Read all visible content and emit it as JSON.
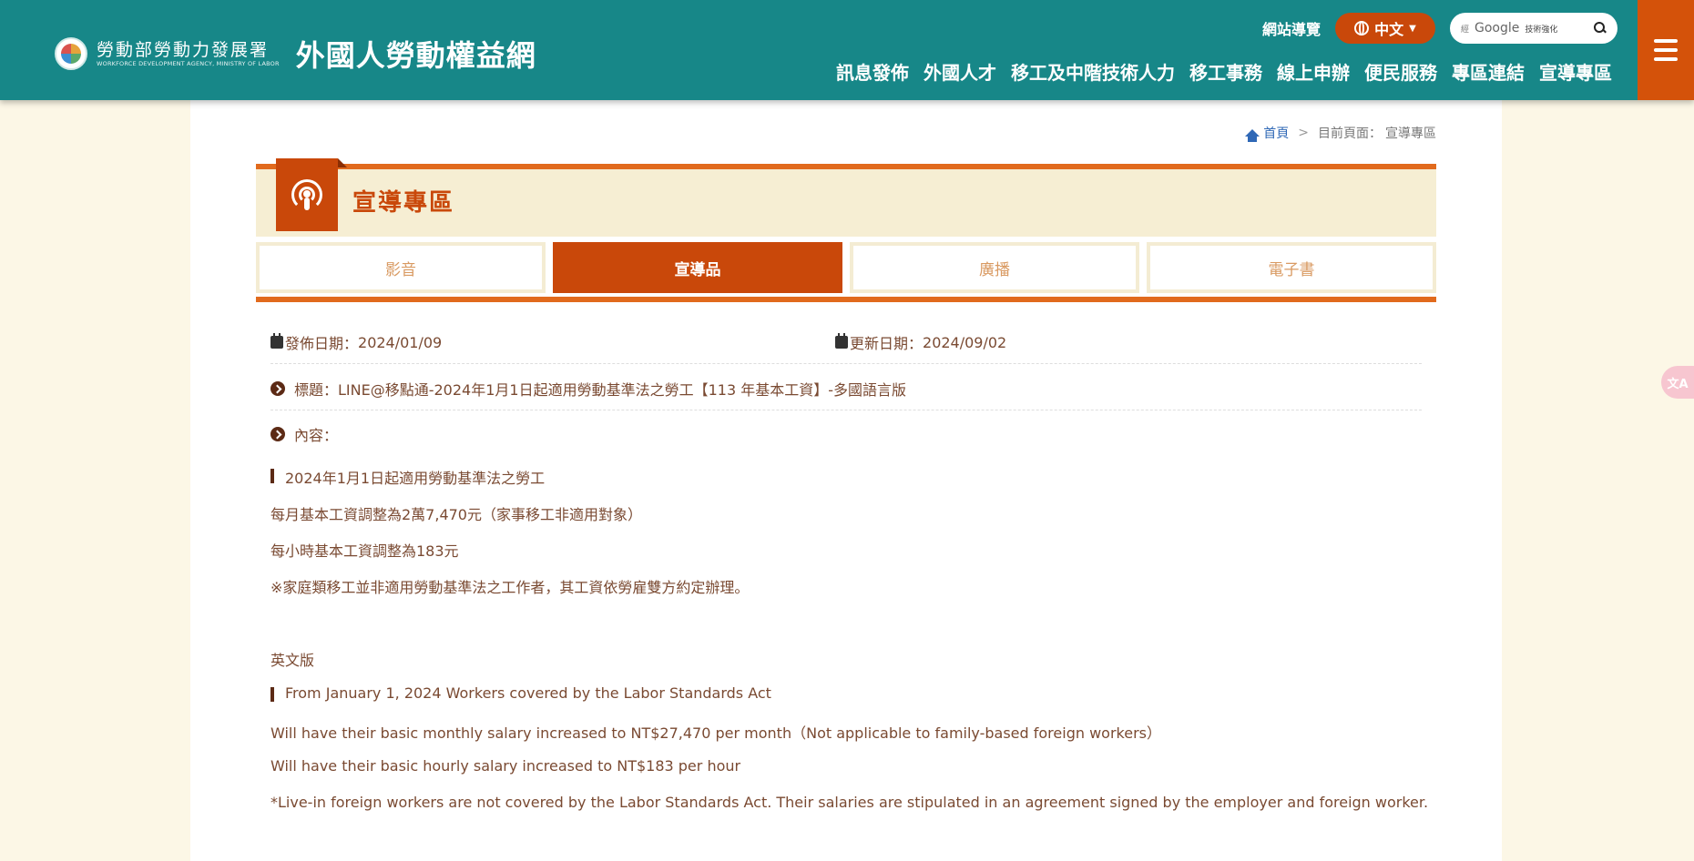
{
  "header": {
    "agency_zh": "勞動部勞動力發展署",
    "agency_en": "WORKFORCE DEVELOPMENT AGENCY, MINISTRY OF LABOR",
    "site_title": "外國人勞動權益網",
    "sitemap": "網站導覽",
    "language": "中文",
    "search_brand": "Google",
    "search_sub": "技術強化",
    "search_mark": "經",
    "nav": [
      "訊息發佈",
      "外國人才",
      "移工及中階技術人力",
      "移工事務",
      "線上申辦",
      "便民服務",
      "專區連結",
      "宣導專區"
    ],
    "colors": {
      "header_bg": "#178788",
      "accent": "#c9480a"
    }
  },
  "breadcrumb": {
    "home": "首頁",
    "separator": ">",
    "current_label": "目前頁面：",
    "current": "宣導專區"
  },
  "section": {
    "title": "宣導專區",
    "icon": "podcast-icon"
  },
  "tabs": [
    {
      "label": "影音",
      "active": false
    },
    {
      "label": "宣導品",
      "active": true
    },
    {
      "label": "廣播",
      "active": false
    },
    {
      "label": "電子書",
      "active": false
    }
  ],
  "article": {
    "publish_label": "發佈日期：",
    "publish_date": "2024/01/09",
    "update_label": "更新日期：",
    "update_date": "2024/09/02",
    "title_label": "標題：",
    "title": "LINE@移點通-2024年1月1日起適用勞動基準法之勞工【113 年基本工資】-多國語言版",
    "content_label": "內容：",
    "content": {
      "zh_heading": "2024年1月1日起適用勞動基準法之勞工",
      "zh_line1": "每月基本工資調整為2萬7,470元（家事移工非適用對象）",
      "zh_line2": "每小時基本工資調整為183元",
      "zh_note": "※家庭類移工並非適用勞動基準法之工作者，其工資依勞雇雙方約定辦理。",
      "en_label": "英文版",
      "en_heading": "From January 1, 2024 Workers covered by the Labor Standards Act",
      "en_line1": "Will have their basic monthly salary increased to NT$27,470 per month（Not applicable to family-based foreign workers）",
      "en_line2": "Will have their basic hourly salary increased to NT$183 per hour",
      "en_note": "*Live-in foreign workers are not covered by the Labor Standards Act. Their salaries are stipulated in an agreement signed by the employer and foreign worker."
    }
  },
  "translate_fab": "文A"
}
